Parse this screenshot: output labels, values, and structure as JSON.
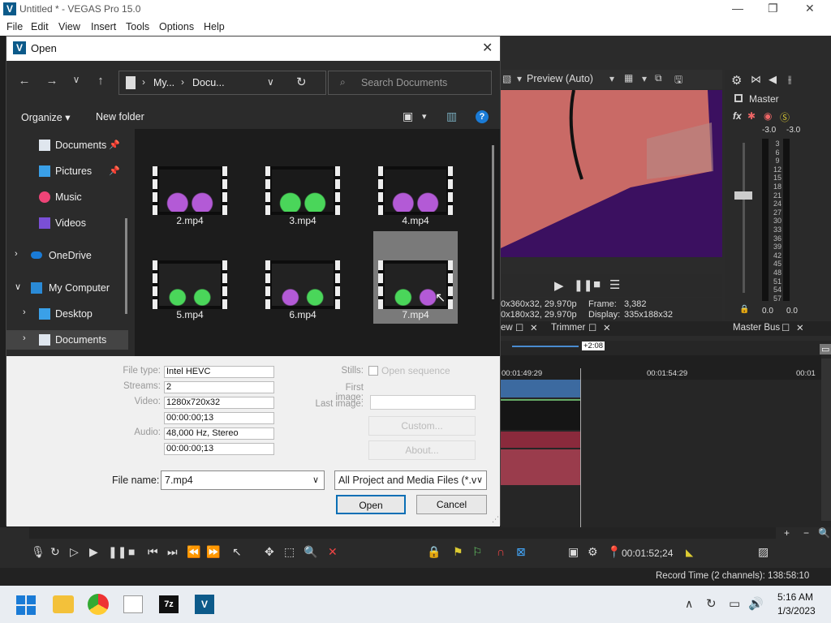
{
  "window": {
    "title": "Untitled * - VEGAS Pro 15.0",
    "app_icon": "V"
  },
  "menu": [
    "File",
    "Edit",
    "View",
    "Insert",
    "Tools",
    "Options",
    "Help"
  ],
  "preview": {
    "label": "Preview (Auto)",
    "line1_left": "0x360x32, 29.970p",
    "line2_left": "0x180x32, 29.970p",
    "frame_label": "Frame:",
    "frame_value": "3,382",
    "display_label": "Display:",
    "display_value": "335x188x32"
  },
  "tabs": {
    "a": "ew",
    "trimmer": "Trimmer",
    "master_bus": "Master Bus"
  },
  "master": {
    "label": "Master",
    "left_peak": "-3.0",
    "right_peak": "-3.0",
    "scale": [
      "3",
      "6",
      "9",
      "12",
      "15",
      "18",
      "21",
      "24",
      "27",
      "30",
      "33",
      "36",
      "39",
      "42",
      "45",
      "48",
      "51",
      "54",
      "57"
    ],
    "left_val": "0.0",
    "right_val": "0.0"
  },
  "timeline": {
    "marker": "+2:08",
    "time1": "00:01:49:29",
    "time2": "00:01:54:29",
    "time3": "00:01"
  },
  "bottom": {
    "timecode": "00:01:52;24"
  },
  "status": {
    "record_time": "Record Time (2 channels): 138:58:10"
  },
  "clock": {
    "time": "5:16 AM",
    "date": "1/3/2023"
  },
  "dialog": {
    "title": "Open",
    "breadcrumb": [
      "My...",
      "Docu..."
    ],
    "search_placeholder": "Search Documents",
    "organize": "Organize",
    "new_folder": "New folder",
    "nav": [
      {
        "label": "Documents",
        "pinned": true
      },
      {
        "label": "Pictures",
        "pinned": true
      },
      {
        "label": "Music"
      },
      {
        "label": "Videos"
      },
      {
        "label": "OneDrive"
      },
      {
        "label": "My Computer"
      },
      {
        "label": "Desktop"
      },
      {
        "label": "Documents"
      }
    ],
    "files": [
      "2.mp4",
      "3.mp4",
      "4.mp4",
      "5.mp4",
      "6.mp4",
      "7.mp4"
    ],
    "props": {
      "file_type_label": "File type:",
      "file_type": "Intel HEVC",
      "streams_label": "Streams:",
      "streams": "2",
      "video_label": "Video:",
      "video": "1280x720x32",
      "video_len": "00:00:00;13",
      "audio_label": "Audio:",
      "audio": "48,000 Hz, Stereo",
      "audio_len": "00:00:00;13",
      "stills_label": "Stills:",
      "open_sequence": "Open sequence",
      "first_image": "First image:",
      "last_image": "Last image:",
      "custom": "Custom...",
      "about": "About..."
    },
    "file_name_label": "File name:",
    "file_name": "7.mp4",
    "filter": "All Project and Media Files (*.ve",
    "open": "Open",
    "cancel": "Cancel"
  },
  "colors": {
    "accent": "#0a6fb5",
    "selection": "#cfcfcf",
    "preview_bg": "#3b1060"
  }
}
